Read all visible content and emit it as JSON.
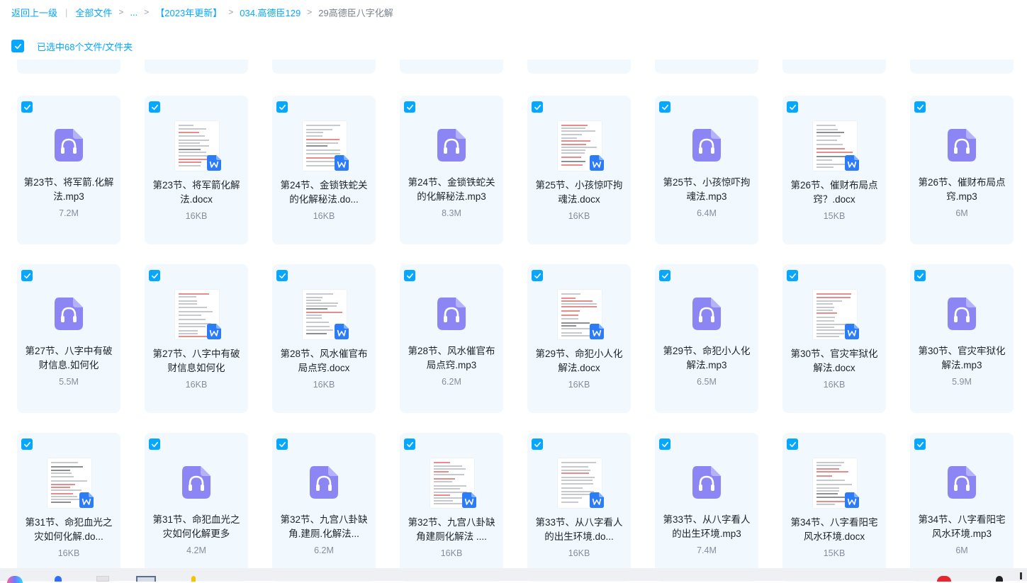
{
  "breadcrumb": {
    "back": "返回上一级",
    "all_files": "全部文件",
    "ellipsis": "...",
    "folder1": "【2023年更新】",
    "folder2": "034.高德臣129",
    "current": "29高德臣八字化解"
  },
  "selection": {
    "text": "已选中68个文件/文件夹"
  },
  "colors": {
    "accent": "#06a7ff",
    "card_bg": "#f1f9fe",
    "audio_icon": "#8b86f3",
    "word_badge": "#2b7cf6"
  },
  "files": [
    {
      "name": "第23节、将军箭.化解法.mp3",
      "size": "7.2M",
      "type": "audio",
      "icon": "audio-file-icon"
    },
    {
      "name": "第23节、将军箭化解法.docx",
      "size": "16KB",
      "type": "doc",
      "icon": "word-file-icon"
    },
    {
      "name": "第24节、金锁铁蛇关的化解秘法.do...",
      "size": "16KB",
      "type": "doc",
      "icon": "word-file-icon"
    },
    {
      "name": "第24节、金锁铁蛇关的化解秘法.mp3",
      "size": "8.3M",
      "type": "audio",
      "icon": "audio-file-icon"
    },
    {
      "name": "第25节、小孩惊吓拘魂法.docx",
      "size": "16KB",
      "type": "doc",
      "icon": "word-file-icon"
    },
    {
      "name": "第25节、小孩惊吓拘魂法.mp3",
      "size": "6.4M",
      "type": "audio",
      "icon": "audio-file-icon"
    },
    {
      "name": "第26节、催财布局点窍？.docx",
      "size": "15KB",
      "type": "doc",
      "icon": "word-file-icon"
    },
    {
      "name": "第26节、催财布局点窍.mp3",
      "size": "6M",
      "type": "audio",
      "icon": "audio-file-icon"
    },
    {
      "name": "第27节、八字中有破财信息.如何化",
      "size": "5.5M",
      "type": "audio",
      "icon": "audio-file-icon"
    },
    {
      "name": "第27节、八字中有破财信息如何化",
      "size": "16KB",
      "type": "doc",
      "icon": "word-file-icon"
    },
    {
      "name": "第28节、风水催官布局点窍.docx",
      "size": "16KB",
      "type": "doc",
      "icon": "word-file-icon"
    },
    {
      "name": "第28节、风水催官布局点窍.mp3",
      "size": "6.2M",
      "type": "audio",
      "icon": "audio-file-icon"
    },
    {
      "name": "第29节、命犯小人化解法.docx",
      "size": "16KB",
      "type": "doc",
      "icon": "word-file-icon"
    },
    {
      "name": "第29节、命犯小人化解法.mp3",
      "size": "6.5M",
      "type": "audio",
      "icon": "audio-file-icon"
    },
    {
      "name": "第30节、官灾牢狱化解法.docx",
      "size": "16KB",
      "type": "doc",
      "icon": "word-file-icon"
    },
    {
      "name": "第30节、官灾牢狱化解法.mp3",
      "size": "5.9M",
      "type": "audio",
      "icon": "audio-file-icon"
    },
    {
      "name": "第31节、命犯血光之灾如何化解.do...",
      "size": "16KB",
      "type": "doc",
      "icon": "word-file-icon"
    },
    {
      "name": "第31节、命犯血光之灾如何化解更多",
      "size": "4.2M",
      "type": "audio",
      "icon": "audio-file-icon"
    },
    {
      "name": "第32节、九宫八卦缺角.建厕.化解法...",
      "size": "6.2M",
      "type": "audio",
      "icon": "audio-file-icon"
    },
    {
      "name": "第32节、九宫八卦缺角建厕化解法 ....",
      "size": "16KB",
      "type": "doc",
      "icon": "word-file-icon"
    },
    {
      "name": "第33节、从八字看人的出生环境.do...",
      "size": "16KB",
      "type": "doc",
      "icon": "word-file-icon"
    },
    {
      "name": "第33节、从八字看人的出生环境.mp3",
      "size": "7.4M",
      "type": "audio",
      "icon": "audio-file-icon"
    },
    {
      "name": "第34节、八字看阳宅风水环境.docx",
      "size": "15KB",
      "type": "doc",
      "icon": "word-file-icon"
    },
    {
      "name": "第34节、八字看阳宅风水环境.mp3",
      "size": "6M",
      "type": "audio",
      "icon": "audio-file-icon"
    }
  ]
}
